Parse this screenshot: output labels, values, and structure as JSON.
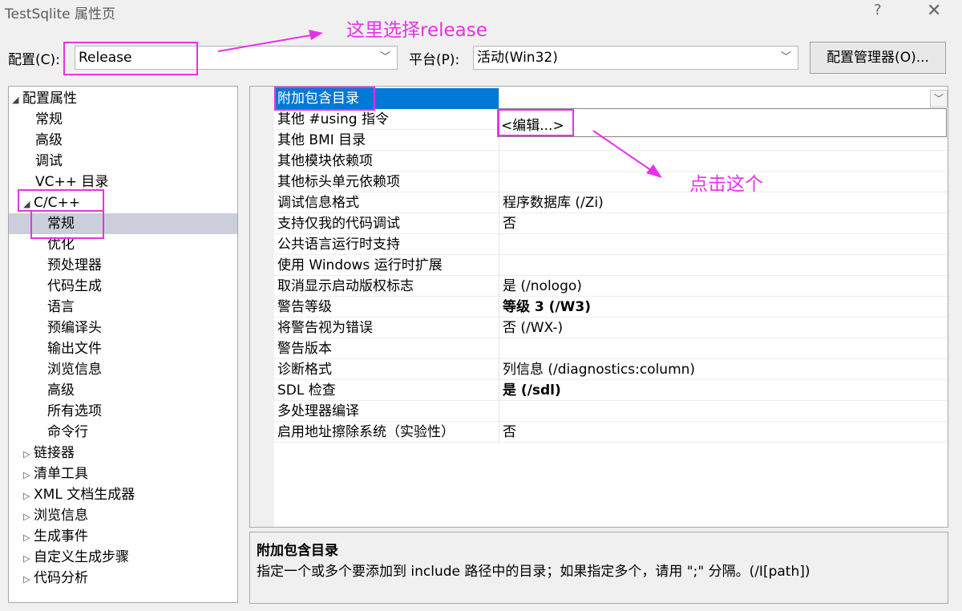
{
  "window": {
    "title": "TestSqlite 属性页",
    "help_glyph": "?",
    "close_glyph": "✕"
  },
  "config": {
    "label": "配置(C):",
    "value": "Release",
    "platform_label": "平台(P):",
    "platform_value": "活动(Win32)",
    "manager_button": "配置管理器(O)..."
  },
  "tree": {
    "items": [
      {
        "label": "配置属性",
        "expander": "◢"
      },
      {
        "label": "常规"
      },
      {
        "label": "高级"
      },
      {
        "label": "调试"
      },
      {
        "label": "VC++ 目录"
      },
      {
        "label": "C/C++",
        "expander": "◢"
      },
      {
        "label": "常规"
      },
      {
        "label": "优化"
      },
      {
        "label": "预处理器"
      },
      {
        "label": "代码生成"
      },
      {
        "label": "语言"
      },
      {
        "label": "预编译头"
      },
      {
        "label": "输出文件"
      },
      {
        "label": "浏览信息"
      },
      {
        "label": "高级"
      },
      {
        "label": "所有选项"
      },
      {
        "label": "命令行"
      },
      {
        "label": "链接器",
        "expander": "▷"
      },
      {
        "label": "清单工具",
        "expander": "▷"
      },
      {
        "label": "XML 文档生成器",
        "expander": "▷"
      },
      {
        "label": "浏览信息",
        "expander": "▷"
      },
      {
        "label": "生成事件",
        "expander": "▷"
      },
      {
        "label": "自定义生成步骤",
        "expander": "▷"
      },
      {
        "label": "代码分析",
        "expander": "▷"
      }
    ]
  },
  "properties": {
    "rows": [
      {
        "name": "附加包含目录",
        "value": ""
      },
      {
        "name": "其他 #using 指令",
        "value": ""
      },
      {
        "name": "其他 BMI 目录",
        "value": ""
      },
      {
        "name": "其他模块依赖项",
        "value": ""
      },
      {
        "name": "其他标头单元依赖项",
        "value": ""
      },
      {
        "name": "调试信息格式",
        "value": "程序数据库 (/Zi)"
      },
      {
        "name": "支持仅我的代码调试",
        "value": "否"
      },
      {
        "name": "公共语言运行时支持",
        "value": ""
      },
      {
        "name": "使用 Windows 运行时扩展",
        "value": ""
      },
      {
        "name": "取消显示启动版权标志",
        "value": "是 (/nologo)"
      },
      {
        "name": "警告等级",
        "value": "等级 3 (/W3)"
      },
      {
        "name": "将警告视为错误",
        "value": "否 (/WX-)"
      },
      {
        "name": "警告版本",
        "value": ""
      },
      {
        "name": "诊断格式",
        "value": "列信息 (/diagnostics:column)"
      },
      {
        "name": "SDL 检查",
        "value": "是 (/sdl)"
      },
      {
        "name": "多处理器编译",
        "value": ""
      },
      {
        "name": "启用地址擦除系统（实验性）",
        "value": "否"
      }
    ],
    "dropdown_option": "<编辑...>"
  },
  "description": {
    "title": "附加包含目录",
    "text": "指定一个或多个要添加到 include 路径中的目录；如果指定多个，请用 \";\" 分隔。(/I[path])"
  },
  "annotations": {
    "select_release": "这里选择release",
    "click_this": "点击这个",
    "color": "#e632e6"
  }
}
